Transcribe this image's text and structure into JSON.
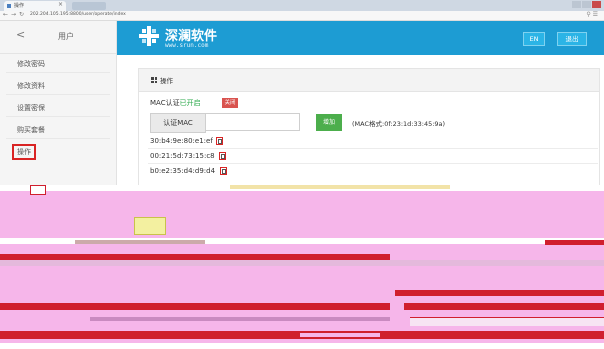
{
  "browser": {
    "tab_title": "操作",
    "url": "202.204.105.195:8800/user/operate/index"
  },
  "sidebar": {
    "title": "用户",
    "back": "<",
    "items": [
      {
        "label": "修改密码"
      },
      {
        "label": "修改资料"
      },
      {
        "label": "设置密保"
      },
      {
        "label": "购买套餐"
      },
      {
        "label": "操作",
        "active": true
      }
    ]
  },
  "header": {
    "brand_cn": "深澜软件",
    "brand_en": "www.srun.com",
    "lang_button": "EN",
    "logout_button": "退出"
  },
  "panel": {
    "title": "操作",
    "mac_auth_prefix": "MAC认证",
    "mac_auth_status": "已开启",
    "close_button": "关闭",
    "auth_mac_label": "认证MAC",
    "auth_mac_value": "",
    "add_button": "增加",
    "mac_format_hint": "(MAC格式:0f:23:1d:33:45:9a)",
    "mac_list": [
      "30:b4:9e:80:e1:ef",
      "00:21:5d:73:15:c8",
      "b0:e2:35:d4:d9:d4"
    ]
  },
  "colors": {
    "brand_blue": "#1d9cd3",
    "green": "#4cae4c",
    "red": "#d9534f",
    "glitch_pink": "#f4a7e6",
    "glitch_red": "#d01f2e"
  }
}
